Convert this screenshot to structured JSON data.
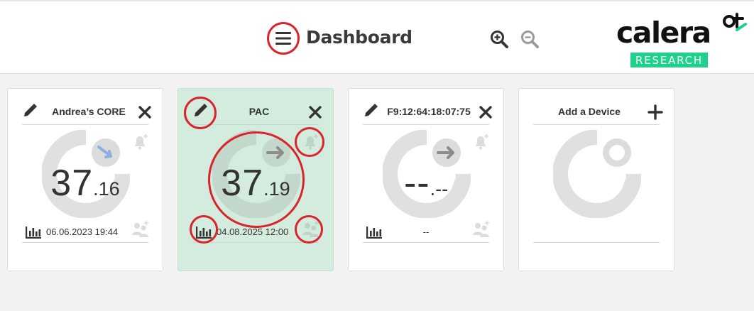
{
  "header": {
    "title": "Dashboard",
    "menu_icon": "hamburger-menu-icon",
    "zoom_in_icon": "zoom-in-icon",
    "zoom_out_icon": "zoom-out-icon"
  },
  "logo": {
    "word": "calera",
    "subtitle": "RESEARCH",
    "colors": {
      "text": "#111111",
      "accent": "#1fd28b"
    }
  },
  "cards": [
    {
      "title": "Andrea’s CORE",
      "temp_int": "37",
      "temp_dec": ".16",
      "timestamp": "06.06.2023 19:44",
      "arrow": "down-right",
      "active": false
    },
    {
      "title": "PAC",
      "temp_int": "37",
      "temp_dec": ".19",
      "timestamp": "04.08.2025 12:00",
      "arrow": "right",
      "active": true
    },
    {
      "title": "F9:12:64:18:07:75",
      "temp_int": "--",
      "temp_dec": ".--",
      "timestamp": "--",
      "arrow": "right",
      "active": false
    }
  ],
  "add_card": {
    "title": "Add a Device"
  },
  "colors": {
    "active_card": "#d4ecde",
    "highlight": "#d9242b",
    "gauge": "#dedede"
  }
}
